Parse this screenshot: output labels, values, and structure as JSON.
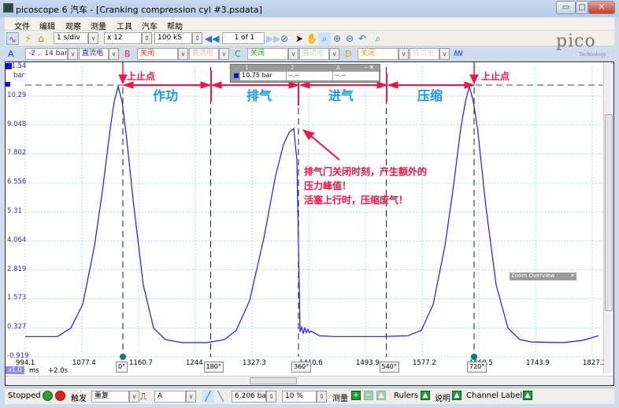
{
  "window": {
    "title": "picoscope 6 汽车 - [Cranking compression cyl #3.psdata]",
    "minimize": "▭",
    "maximize": "□",
    "close": "✕"
  },
  "menu": [
    "文件",
    "编辑",
    "观察",
    "测量",
    "工具",
    "汽车",
    "帮助"
  ],
  "toolbar1": {
    "timebase": "1 s/div",
    "zoom": "x 12",
    "samples": "100 kS",
    "buffer": "1 of 1"
  },
  "toolbar2": {
    "chA": {
      "label": "A",
      "range": "-2 .. 14 bar",
      "coupling": "直流电"
    },
    "chB": {
      "label": "B",
      "range": "关闭",
      "coupling": "直流电"
    },
    "chC": {
      "label": "C",
      "range": "关闭",
      "coupling": "直流电"
    },
    "chD": {
      "label": "D",
      "range": "关闭",
      "coupling": "直流电"
    }
  },
  "logo": {
    "name": "pico",
    "sub": "Technology"
  },
  "ruler_box": {
    "col1": "1",
    "col2": "2",
    "col3": "Δ",
    "v1": "10.75 bar",
    "v2": "--.--",
    "v3": "--.--"
  },
  "zoom_overview": "Zoom Overview",
  "plot": {
    "y_unit": "bar",
    "y_top": "11.54",
    "y_ticks": [
      "10.29",
      "9.048",
      "7.802",
      "6.556",
      "5.31",
      "4.064",
      "2.819",
      "1.573",
      "0.327",
      "-0.919"
    ],
    "x_ticks": [
      "994.1",
      "1077.4",
      "1160.7",
      "1244",
      "1327.3",
      "1410.6",
      "1493.9",
      "1577.2",
      "1660.5",
      "1743.9",
      "1827.2"
    ],
    "x_unit": "ms",
    "x_zoom": "x1.0",
    "x_offset": "+2.0s",
    "degree_markers": [
      "0°",
      "180°",
      "360°",
      "540°",
      "720°"
    ],
    "trace_color": "#1a1aff"
  },
  "annotations": {
    "tdc_left": "上止点",
    "tdc_right": "上止点",
    "strokes": [
      "作功",
      "排气",
      "进气",
      "压缩"
    ],
    "note1": "排气门关闭时刻，产生额外的",
    "note2": "压力峰值！",
    "note3": "活塞上行时，压缩废气！"
  },
  "chart_data": {
    "type": "line",
    "xlabel": "ms",
    "ylabel": "bar",
    "xlim": [
      994.1,
      1827.2
    ],
    "ylim": [
      -0.919,
      11.54
    ],
    "grid": true,
    "ruler_level": 10.75,
    "series": [
      {
        "values": [
          [
            994.1,
            -0.05
          ],
          [
            1041.5,
            -0.05
          ],
          [
            1061.2,
            0.32
          ],
          [
            1078.5,
            1.33
          ],
          [
            1095.9,
            3.85
          ],
          [
            1107.5,
            6.2
          ],
          [
            1119.0,
            8.89
          ],
          [
            1124.8,
            10.06
          ],
          [
            1130.6,
            10.7
          ],
          [
            1136.4,
            10.06
          ],
          [
            1142.2,
            8.72
          ],
          [
            1153.8,
            5.53
          ],
          [
            1167.6,
            2.17
          ],
          [
            1182.7,
            0.32
          ],
          [
            1200.0,
            -0.18
          ],
          [
            1225.5,
            -0.31
          ],
          [
            1260.2,
            -0.31
          ],
          [
            1286.8,
            -0.18
          ],
          [
            1304.2,
            0.22
          ],
          [
            1323.8,
            1.5
          ],
          [
            1344.7,
            4.18
          ],
          [
            1362.0,
            6.87
          ],
          [
            1373.6,
            8.21
          ],
          [
            1381.7,
            8.72
          ],
          [
            1388.6,
            8.89
          ],
          [
            1393.3,
            7.54
          ],
          [
            1397.9,
            0.15
          ],
          [
            1400.2,
            0.36
          ],
          [
            1402.5,
            0.09
          ],
          [
            1404.8,
            0.32
          ],
          [
            1407.1,
            0.12
          ],
          [
            1409.4,
            0.26
          ],
          [
            1411.8,
            0.12
          ],
          [
            1414.1,
            0.19
          ],
          [
            1425.7,
            -0.01
          ],
          [
            1448.8,
            -0.05
          ],
          [
            1518.2,
            -0.05
          ],
          [
            1556.4,
            -0.01
          ],
          [
            1576.0,
            0.22
          ],
          [
            1593.4,
            1.33
          ],
          [
            1610.7,
            3.85
          ],
          [
            1622.3,
            6.2
          ],
          [
            1633.9,
            8.89
          ],
          [
            1640.8,
            10.06
          ],
          [
            1646.6,
            10.7
          ],
          [
            1652.4,
            10.06
          ],
          [
            1659.4,
            8.72
          ],
          [
            1670.9,
            5.53
          ],
          [
            1686.0,
            2.17
          ],
          [
            1703.3,
            0.32
          ],
          [
            1720.7,
            -0.18
          ],
          [
            1738.0,
            -0.28
          ],
          [
            1784.3,
            -0.31
          ],
          [
            1813.2,
            -0.21
          ],
          [
            1836.3,
            -0.01
          ]
        ]
      }
    ]
  },
  "status": {
    "state": "Stopped",
    "trigger_label": "触发",
    "trigger_mode": "重复",
    "trigger_source": "A",
    "trigger_level": "6.206 bar",
    "pretrigger": "10 %",
    "measure_label": "测量",
    "rulers_label": "Rulers",
    "notes_label": "说明",
    "channel_labels_label": "Channel Labels"
  }
}
